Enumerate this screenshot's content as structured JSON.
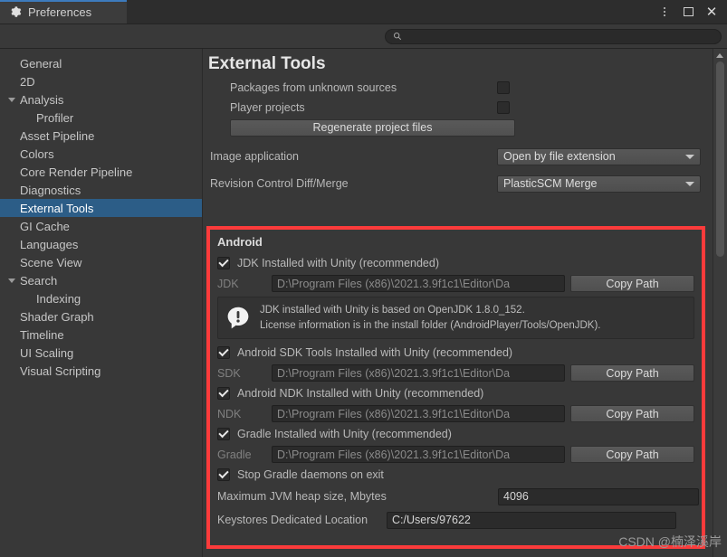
{
  "window": {
    "tab_label": "Preferences",
    "gear_icon": "gear-icon",
    "controls": {
      "menu": "kebab-menu-icon",
      "maximize": "maximize-icon",
      "close": "close-icon"
    }
  },
  "search": {
    "value": "",
    "placeholder": "",
    "icon": "search-icon"
  },
  "sidebar": {
    "items": [
      {
        "label": "General",
        "level": 0,
        "expandable": false,
        "selected": false
      },
      {
        "label": "2D",
        "level": 0,
        "expandable": false,
        "selected": false
      },
      {
        "label": "Analysis",
        "level": 0,
        "expandable": true,
        "selected": false
      },
      {
        "label": "Profiler",
        "level": 1,
        "expandable": false,
        "selected": false
      },
      {
        "label": "Asset Pipeline",
        "level": 0,
        "expandable": false,
        "selected": false
      },
      {
        "label": "Colors",
        "level": 0,
        "expandable": false,
        "selected": false
      },
      {
        "label": "Core Render Pipeline",
        "level": 0,
        "expandable": false,
        "selected": false
      },
      {
        "label": "Diagnostics",
        "level": 0,
        "expandable": false,
        "selected": false
      },
      {
        "label": "External Tools",
        "level": 0,
        "expandable": false,
        "selected": true
      },
      {
        "label": "GI Cache",
        "level": 0,
        "expandable": false,
        "selected": false
      },
      {
        "label": "Languages",
        "level": 0,
        "expandable": false,
        "selected": false
      },
      {
        "label": "Scene View",
        "level": 0,
        "expandable": false,
        "selected": false
      },
      {
        "label": "Search",
        "level": 0,
        "expandable": true,
        "selected": false
      },
      {
        "label": "Indexing",
        "level": 1,
        "expandable": false,
        "selected": false
      },
      {
        "label": "Shader Graph",
        "level": 0,
        "expandable": false,
        "selected": false
      },
      {
        "label": "Timeline",
        "level": 0,
        "expandable": false,
        "selected": false
      },
      {
        "label": "UI Scaling",
        "level": 0,
        "expandable": false,
        "selected": false
      },
      {
        "label": "Visual Scripting",
        "level": 0,
        "expandable": false,
        "selected": false
      }
    ]
  },
  "main": {
    "title": "External Tools",
    "packages_unknown_label": "Packages from unknown sources",
    "packages_unknown_checked": false,
    "player_projects_label": "Player projects",
    "player_projects_checked": false,
    "regenerate_button": "Regenerate project files",
    "image_application_label": "Image application",
    "image_application_value": "Open by file extension",
    "revision_control_label": "Revision Control Diff/Merge",
    "revision_control_value": "PlasticSCM Merge"
  },
  "android": {
    "section_title": "Android",
    "highlight_color": "#fb3b3b",
    "jdk_checkbox_label": "JDK Installed with Unity (recommended)",
    "jdk_checked": true,
    "jdk_key": "JDK",
    "jdk_path": "D:\\Program Files (x86)\\2021.3.9f1c1\\Editor\\Da",
    "jdk_copy_button": "Copy Path",
    "info_icon": "warning-bubble-icon",
    "info_line1": "JDK installed with Unity is based on OpenJDK 1.8.0_152.",
    "info_line2": "License information is in the install folder (AndroidPlayer/Tools/OpenJDK).",
    "sdk_checkbox_label": "Android SDK Tools Installed with Unity (recommended)",
    "sdk_checked": true,
    "sdk_key": "SDK",
    "sdk_path": "D:\\Program Files (x86)\\2021.3.9f1c1\\Editor\\Da",
    "sdk_copy_button": "Copy Path",
    "ndk_checkbox_label": "Android NDK Installed with Unity (recommended)",
    "ndk_checked": true,
    "ndk_key": "NDK",
    "ndk_path": "D:\\Program Files (x86)\\2021.3.9f1c1\\Editor\\Da",
    "ndk_copy_button": "Copy Path",
    "gradle_checkbox_label": "Gradle Installed with Unity (recommended)",
    "gradle_checked": true,
    "gradle_key": "Gradle",
    "gradle_path": "D:\\Program Files (x86)\\2021.3.9f1c1\\Editor\\Da",
    "gradle_copy_button": "Copy Path",
    "stop_daemons_label": "Stop Gradle daemons on exit",
    "stop_daemons_checked": true,
    "jvm_heap_label": "Maximum JVM heap size, Mbytes",
    "jvm_heap_value": "4096",
    "keystore_label": "Keystores Dedicated Location",
    "keystore_value": "C:/Users/97622"
  },
  "watermark": "CSDN @楠泽溪岸"
}
